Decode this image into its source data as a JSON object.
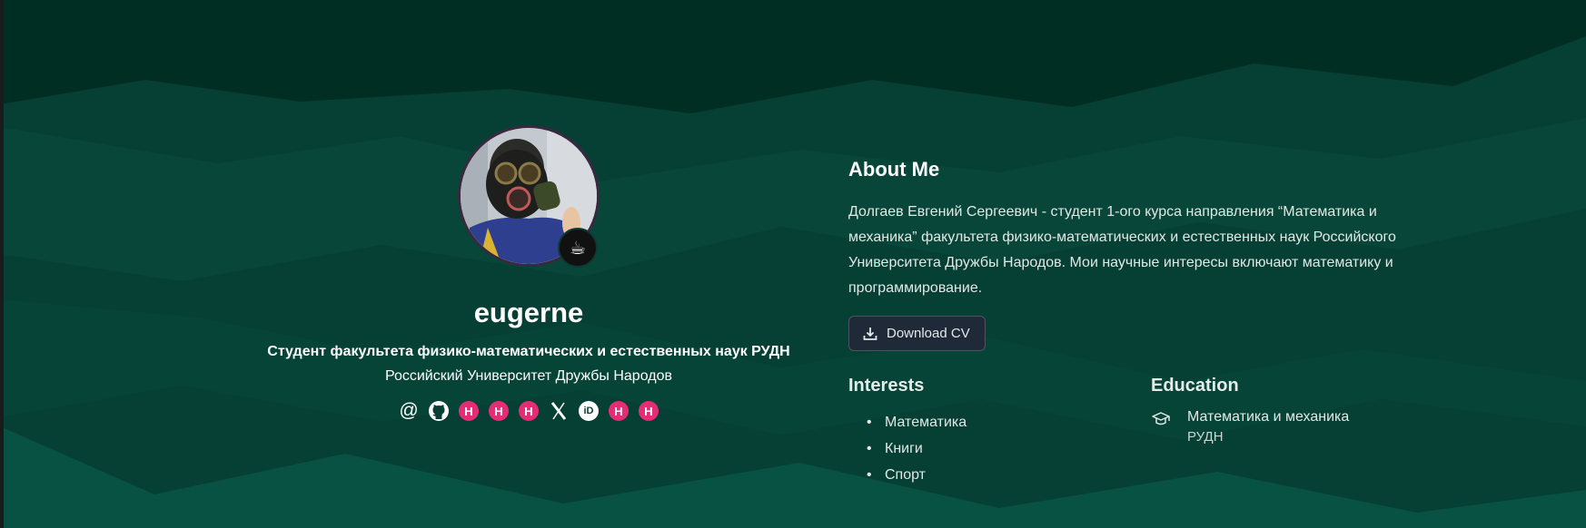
{
  "profile": {
    "status_emoji": "☕",
    "name": "eugerne",
    "role": "Студент факультета физико-математических и естественных наук РУДН",
    "organization": "Российский Университет Дружбы Народов",
    "socials": [
      {
        "icon": "at-icon"
      },
      {
        "icon": "github-icon"
      },
      {
        "icon": "hal-icon",
        "text": "H"
      },
      {
        "icon": "hal-icon",
        "text": "H"
      },
      {
        "icon": "hal-icon",
        "text": "H"
      },
      {
        "icon": "x-twitter-icon"
      },
      {
        "icon": "orcid-icon",
        "text": "iD"
      },
      {
        "icon": "hal-icon",
        "text": "H"
      },
      {
        "icon": "hal-icon",
        "text": "H"
      }
    ]
  },
  "about": {
    "title": "About Me",
    "text": "Долгаев Евгений Сергеевич - студент 1-ого курса направления “Математика и механика” факультета физико-математических и естественных наук Российского Университета Дружбы Народов. Мои научные интересы включают математику и программирование.",
    "cv_label": "Download CV"
  },
  "interests": {
    "title": "Interests",
    "items": [
      "Математика",
      "Книги",
      "Спорт"
    ]
  },
  "education": {
    "title": "Education",
    "items": [
      {
        "degree": "Математика и механика",
        "institution": "РУДН"
      }
    ]
  },
  "colors": {
    "background": "#063f33",
    "accent_pink": "#e52d75",
    "button_bg": "#1f2937"
  }
}
